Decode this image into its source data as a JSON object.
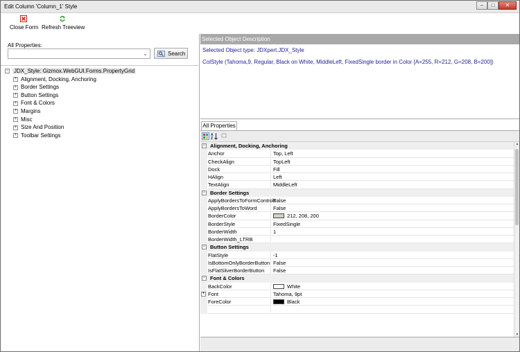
{
  "window": {
    "title": "Edit Column 'Column_1' Style",
    "buttons": {
      "minimize": "–",
      "maximize": "□",
      "close": "✕"
    }
  },
  "toolbar": {
    "close_form_label": "Close Form",
    "refresh_label": "Refresh Treeview",
    "close_form_icon": "red-x-icon",
    "refresh_icon": "green-refresh-icon"
  },
  "left": {
    "all_properties_label": "All Properties:",
    "combo_value": "",
    "search_label": "Search",
    "tree": {
      "root": "JDX_Style: Gizmox.WebGUI.Forms.PropertyGrid",
      "children": [
        "Alignment, Docking, Anchoring",
        "Border Settings",
        "Button Settings",
        "Font & Colors",
        "Margins",
        "Misc",
        "Size And Position",
        "Toolbar Settings"
      ]
    }
  },
  "description": {
    "header": "Selected Object Description",
    "line1": "Selected Object type: JDXpert.JDX_Style",
    "line2": "ColStyle (Tahoma,9, Regular, Black on White, MiddleLeft, FixedSingle border in Color [A=255, R=212, G=208, B=200])"
  },
  "property_grid": {
    "tab_label": "All Properties",
    "categories": [
      {
        "name": "Alignment, Docking, Anchoring",
        "props": [
          {
            "name": "Anchor",
            "value": "Top, Left"
          },
          {
            "name": "CheckAlign",
            "value": "TopLeft"
          },
          {
            "name": "Dock",
            "value": "Fill"
          },
          {
            "name": "HAlign",
            "value": "Left"
          },
          {
            "name": "TextAlign",
            "value": "MiddleLeft"
          }
        ]
      },
      {
        "name": "Border Settings",
        "props": [
          {
            "name": "ApplyBordersToFormControls",
            "value": "False"
          },
          {
            "name": "ApplyBordersToWord",
            "value": "False"
          },
          {
            "name": "BorderColor",
            "value": "212, 208, 200",
            "swatch": "#d4d0c8"
          },
          {
            "name": "BorderStyle",
            "value": "FixedSingle"
          },
          {
            "name": "BorderWidth",
            "value": "1"
          },
          {
            "name": "BorderWidth_LTRB",
            "value": ""
          }
        ]
      },
      {
        "name": "Button Settings",
        "props": [
          {
            "name": "FlatStyle",
            "value": "-1"
          },
          {
            "name": "IsBottomOnlyBorderButton",
            "value": "False"
          },
          {
            "name": "IsFlatSilverBorderButton",
            "value": "False"
          }
        ]
      },
      {
        "name": "Font & Colors",
        "props": [
          {
            "name": "BackColor",
            "value": "White",
            "swatch": "#ffffff"
          },
          {
            "name": "Font",
            "value": "Tahoma, 9pt",
            "expandable": true
          },
          {
            "name": "ForeColor",
            "value": "Black",
            "swatch": "#000000"
          }
        ]
      }
    ]
  },
  "colors": {
    "description_text": "#22229a",
    "description_header_bg": "#a8a8a8"
  }
}
